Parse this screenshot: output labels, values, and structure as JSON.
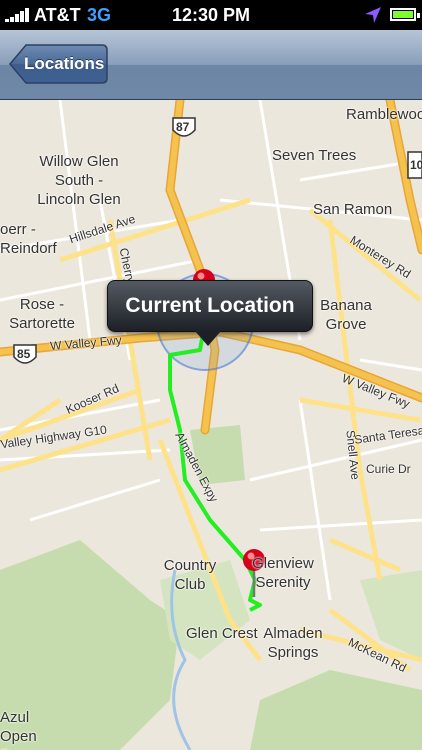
{
  "status_bar": {
    "carrier": "AT&T",
    "network": "3G",
    "time": "12:30 PM",
    "icons": [
      "signal-bars-icon",
      "location-arrow-icon",
      "battery-icon"
    ]
  },
  "nav": {
    "back_label": "Locations"
  },
  "callout": {
    "title": "Current Location"
  },
  "map": {
    "places": [
      "Ramblewood",
      "Willow Glen South - Lincoln Glen",
      "Seven Trees",
      "San Ramon",
      "Rose - Sartorette",
      "Banana Grove",
      "Country Club",
      "Glenview Serenity",
      "Glen Crest",
      "Almaden Springs",
      "Azul Open Preserve",
      "oerr - Reindorf"
    ],
    "roads": [
      "Hillsdale Ave",
      "Cherry Ave",
      "Monterey Rd",
      "W Valley Fwy",
      "W Valley Fwy",
      "Kooser Rd",
      "Almaden Expy",
      "Santa Teresa",
      "Snell Ave",
      "Curie Dr",
      "McKean Rd",
      "Valley Highway G10"
    ],
    "shields": [
      "87",
      "85",
      "10"
    ]
  },
  "colors": {
    "route": "#22ee22",
    "pin": "#d4001c",
    "user_dot": "#1a62d8",
    "freeway": "#f6c24e",
    "park": "#c7dcae"
  }
}
